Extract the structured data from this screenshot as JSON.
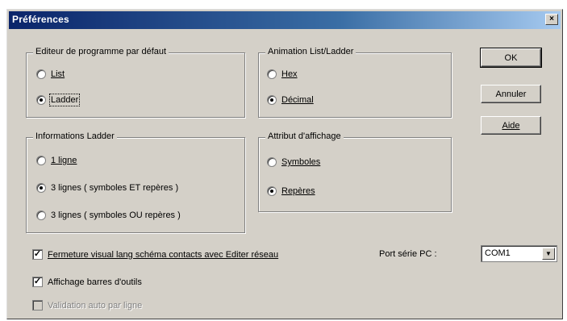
{
  "window": {
    "title": "Préférences",
    "close_glyph": "×"
  },
  "groups": {
    "editor": {
      "title": "Editeur de programme par défaut",
      "options": [
        {
          "label": "List",
          "selected": false
        },
        {
          "label": "Ladder",
          "selected": true
        }
      ]
    },
    "animation": {
      "title": "Animation List/Ladder",
      "options": [
        {
          "label": "Hex",
          "selected": false
        },
        {
          "label": "Décimal",
          "selected": true
        }
      ]
    },
    "ladder_info": {
      "title": "Informations Ladder",
      "options": [
        {
          "label": "1 ligne",
          "selected": false
        },
        {
          "label": "3 lignes ( symboles ET repères )",
          "selected": true
        },
        {
          "label": "3 lignes ( symboles OU repères )",
          "selected": false
        }
      ]
    },
    "display_attr": {
      "title": "Attribut d'affichage",
      "options": [
        {
          "label": "Symboles",
          "selected": false
        },
        {
          "label": "Repères",
          "selected": true
        }
      ]
    }
  },
  "buttons": {
    "ok": "OK",
    "cancel": "Annuler",
    "help": "Aide"
  },
  "checks": {
    "close_visual": {
      "label": "Fermeture visual lang schéma contacts avec Editer réseau",
      "checked": true,
      "enabled": true
    },
    "toolbars": {
      "label": "Affichage barres d'outils",
      "checked": true,
      "enabled": true
    },
    "auto_validation": {
      "label": "Validation auto par ligne",
      "checked": false,
      "enabled": false
    }
  },
  "serial_port": {
    "label": "Port série PC :",
    "value": "COM1"
  },
  "icons": {
    "dropdown": "chevron-down-icon",
    "close": "close-icon"
  }
}
